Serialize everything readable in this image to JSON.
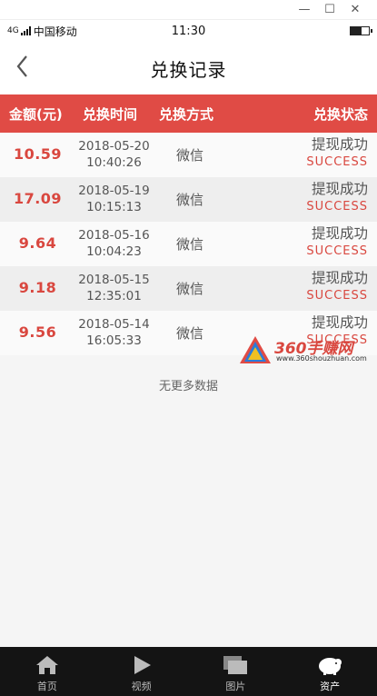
{
  "window": {
    "minimize": "—",
    "maximize": "☐",
    "close": "✕"
  },
  "status_bar": {
    "signal": "4G",
    "carrier": "中国移动",
    "time": "11:30"
  },
  "nav": {
    "title": "兑换记录",
    "back_icon": "chevron-left-icon"
  },
  "table": {
    "headers": {
      "amount": "金额(元)",
      "time": "兑换时间",
      "method": "兑换方式",
      "status": "兑换状态"
    },
    "rows": [
      {
        "amount": "10.59",
        "date": "2018-05-20",
        "clock": "10:40:26",
        "method": "微信",
        "status_cn": "提现成功",
        "status_en": "SUCCESS"
      },
      {
        "amount": "17.09",
        "date": "2018-05-19",
        "clock": "10:15:13",
        "method": "微信",
        "status_cn": "提现成功",
        "status_en": "SUCCESS"
      },
      {
        "amount": "9.64",
        "date": "2018-05-16",
        "clock": "10:04:23",
        "method": "微信",
        "status_cn": "提现成功",
        "status_en": "SUCCESS"
      },
      {
        "amount": "9.18",
        "date": "2018-05-15",
        "clock": "12:35:01",
        "method": "微信",
        "status_cn": "提现成功",
        "status_en": "SUCCESS"
      },
      {
        "amount": "9.56",
        "date": "2018-05-14",
        "clock": "16:05:33",
        "method": "微信",
        "status_cn": "提现成功",
        "status_en": "SUCCESS"
      }
    ],
    "no_more": "无更多数据"
  },
  "watermark": {
    "name": "360手赚网",
    "url": "www.360shouzhuan.com"
  },
  "tabbar": {
    "items": [
      {
        "label": "首页",
        "icon": "home-icon"
      },
      {
        "label": "视频",
        "icon": "play-icon"
      },
      {
        "label": "图片",
        "icon": "images-icon"
      },
      {
        "label": "资产",
        "icon": "piggy-bank-icon"
      }
    ],
    "active_index": 3
  },
  "colors": {
    "accent": "#e04b45",
    "amount": "#d9473f",
    "tabbar_bg": "#141414"
  }
}
